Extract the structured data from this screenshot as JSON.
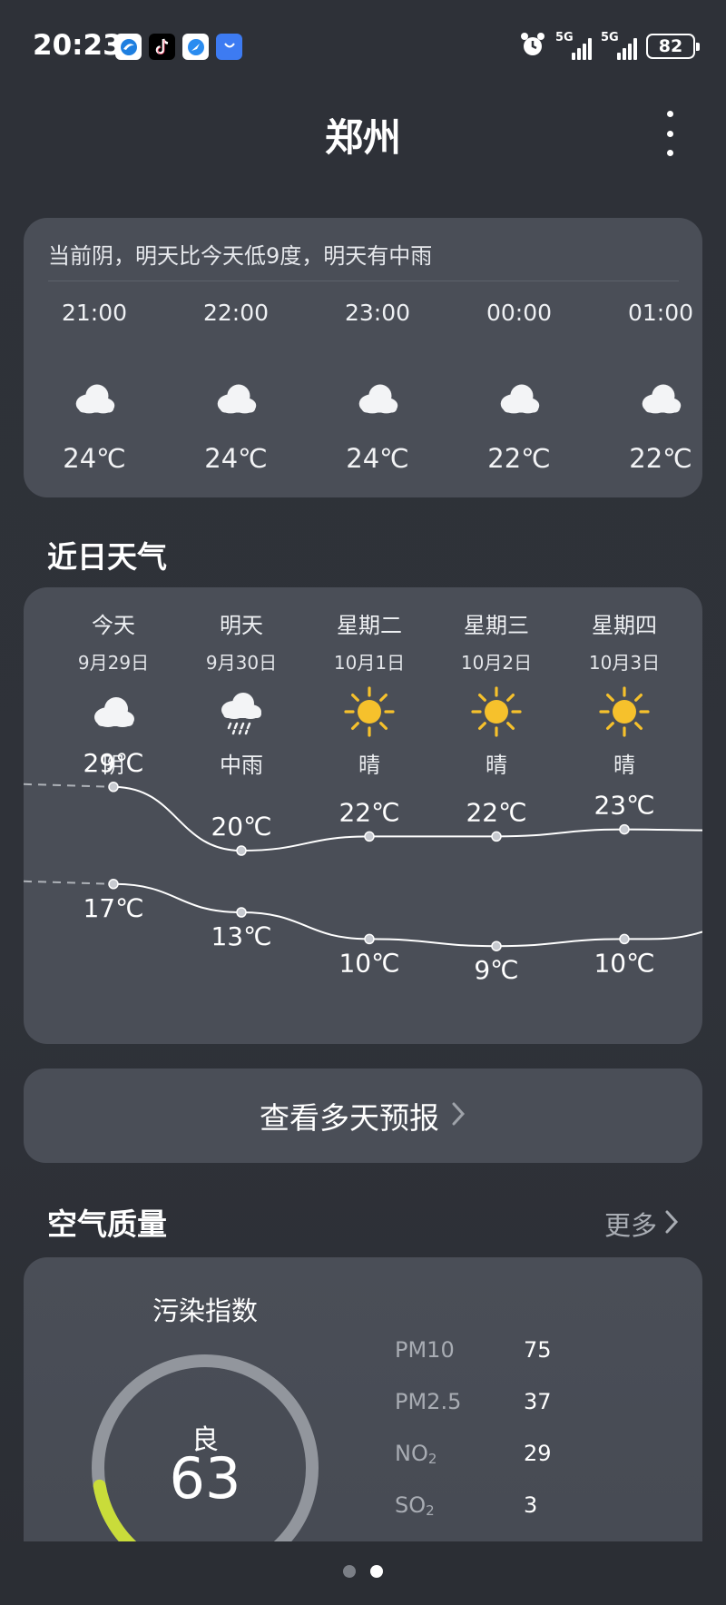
{
  "status_bar": {
    "time": "20:23",
    "apps": [
      "browser-icon",
      "tiktok-icon",
      "safari-like-icon",
      "store-icon"
    ],
    "alarm_icon": "alarm-clock-icon",
    "network1": "5G",
    "network2": "5G",
    "battery": "82"
  },
  "header": {
    "city": "郑州"
  },
  "hourly": {
    "summary": "当前阴，明天比今天低9度，明天有中雨",
    "items": [
      {
        "time": "21:00",
        "icon": "cloudy-icon",
        "temp": "24℃"
      },
      {
        "time": "22:00",
        "icon": "cloudy-icon",
        "temp": "24℃"
      },
      {
        "time": "23:00",
        "icon": "cloudy-icon",
        "temp": "24℃"
      },
      {
        "time": "00:00",
        "icon": "cloudy-icon",
        "temp": "22℃"
      },
      {
        "time": "01:00",
        "icon": "cloudy-icon",
        "temp": "22℃"
      }
    ]
  },
  "recent": {
    "title": "近日天气",
    "days": [
      {
        "name": "今天",
        "date": "9月29日",
        "icon": "cloudy-icon",
        "cond": "阴",
        "high": "29℃",
        "low": "17℃",
        "high_v": 29,
        "low_v": 17
      },
      {
        "name": "明天",
        "date": "9月30日",
        "icon": "rain-icon",
        "cond": "中雨",
        "high": "20℃",
        "low": "13℃",
        "high_v": 20,
        "low_v": 13
      },
      {
        "name": "星期二",
        "date": "10月1日",
        "icon": "sun-icon",
        "cond": "晴",
        "high": "22℃",
        "low": "10℃",
        "high_v": 22,
        "low_v": 10
      },
      {
        "name": "星期三",
        "date": "10月2日",
        "icon": "sun-icon",
        "cond": "晴",
        "high": "22℃",
        "low": "9℃",
        "high_v": 22,
        "low_v": 9
      },
      {
        "name": "星期四",
        "date": "10月3日",
        "icon": "sun-icon",
        "cond": "晴",
        "high": "23℃",
        "low": "10℃",
        "high_v": 23,
        "low_v": 10
      }
    ]
  },
  "forecast_button": {
    "label": "查看多天预报"
  },
  "air_quality": {
    "title": "空气质量",
    "more": "更多",
    "index_label": "污染指数",
    "level": "良",
    "value": "63",
    "gauge_fraction": 0.126,
    "pollutants": [
      {
        "name": "PM10",
        "sub": "",
        "value": "75"
      },
      {
        "name": "PM2.5",
        "sub": "",
        "value": "37"
      },
      {
        "name": "NO",
        "sub": "2",
        "value": "29"
      },
      {
        "name": "SO",
        "sub": "2",
        "value": "3"
      }
    ]
  },
  "colors": {
    "card": "#4a4e57",
    "accent_gauge": "#c9dc3a",
    "sun": "#f6c12c",
    "dot_active": "#ffffff",
    "dot_inactive": "#7b7f86"
  },
  "page_dots": {
    "count": 2,
    "active": 1
  }
}
